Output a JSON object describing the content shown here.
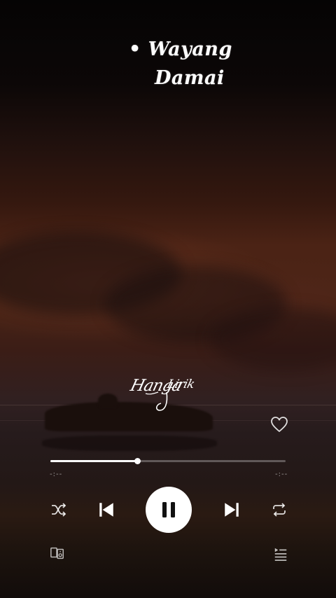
{
  "song": {
    "title_line1": "• Wayang",
    "title_line2": "Damai"
  },
  "watermark": {
    "text": "HangaLirik"
  },
  "playback": {
    "progress_fraction": 0.37,
    "elapsed": "-:--",
    "remaining": "-:--",
    "liked": false
  },
  "icons": {
    "like": "heart-outline-icon",
    "shuffle": "shuffle-icon",
    "previous": "skip-previous-icon",
    "pause": "pause-icon",
    "next": "skip-next-icon",
    "repeat": "repeat-icon",
    "devices": "connect-devices-icon",
    "queue": "queue-icon"
  },
  "colors": {
    "accent": "#ffffff",
    "track_background": "#ffffff47"
  }
}
